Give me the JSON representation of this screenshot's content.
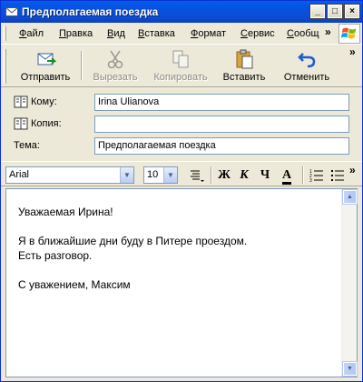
{
  "window": {
    "title": "Предполагаемая поездка",
    "controls": {
      "minimize": "_",
      "maximize": "□",
      "close": "×"
    }
  },
  "menu": {
    "items": [
      "Файл",
      "Правка",
      "Вид",
      "Вставка",
      "Формат",
      "Сервис",
      "Сообщ"
    ],
    "overflow": "»"
  },
  "toolbar": {
    "send": "Отправить",
    "cut": "Вырезать",
    "copy": "Копировать",
    "paste": "Вставить",
    "undo": "Отменить",
    "overflow": "»"
  },
  "fields": {
    "to_label": "Кому:",
    "to_value": "Irina Ulianova",
    "cc_label": "Копия:",
    "cc_value": "",
    "subject_label": "Тема:",
    "subject_value": "Предполагаемая поездка"
  },
  "format": {
    "font": "Arial",
    "size": "10",
    "bold": "Ж",
    "italic": "К",
    "underline": "Ч",
    "font_color": "А"
  },
  "message": {
    "text": "Уважаемая Ирина!\n\nЯ в ближайшие дни буду в Питере проездом.\nЕсть разговор.\n\nС уважением, Максим"
  },
  "colors": {
    "titlebar": "#0a5ee0",
    "window_face": "#ece9d8",
    "input_border": "#7f9db9"
  }
}
